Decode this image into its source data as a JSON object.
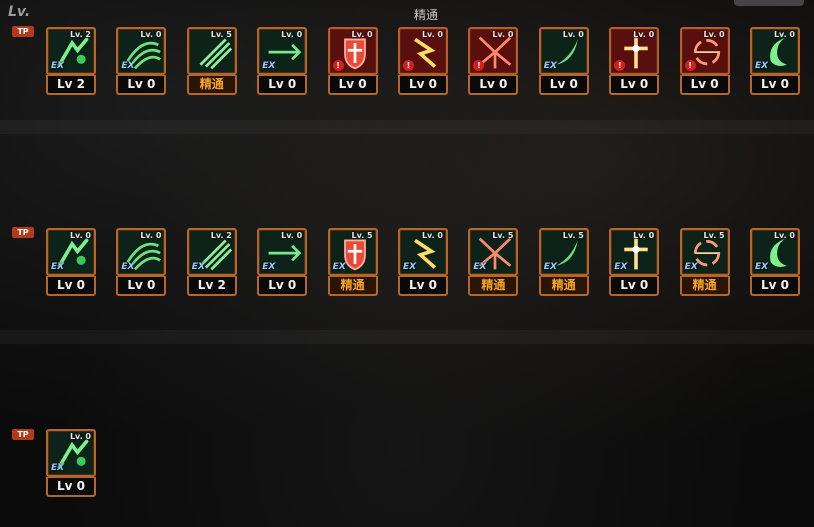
{
  "header": {
    "lv_label": "Lv.",
    "title": "精通"
  },
  "tp_label": "TP",
  "colors": {
    "accent_border": "#b5672a",
    "green_icon_bg": "#0d2218",
    "red_icon_bg": "#5a0f0f",
    "master_text": "#f3a325"
  },
  "rows": [
    {
      "slots": [
        {
          "mini": "Lv. 2",
          "badge": "EX",
          "red": false,
          "label": "Lv 2",
          "master": false,
          "icon": "kick-icon"
        },
        {
          "mini": "Lv. 0",
          "badge": "EX",
          "red": false,
          "label": "Lv 0",
          "master": false,
          "icon": "claw-slash-icon"
        },
        {
          "mini": "Lv. 5",
          "badge": "",
          "red": false,
          "label": "精通",
          "master": true,
          "icon": "triple-slash-icon"
        },
        {
          "mini": "Lv. 0",
          "badge": "EX",
          "red": false,
          "label": "Lv 0",
          "master": false,
          "icon": "sword-thrust-icon"
        },
        {
          "mini": "Lv. 0",
          "badge": "!",
          "red": true,
          "label": "Lv 0",
          "master": false,
          "icon": "shield-cross-icon"
        },
        {
          "mini": "Lv. 0",
          "badge": "!",
          "red": true,
          "label": "Lv 0",
          "master": false,
          "icon": "lightning-strike-icon"
        },
        {
          "mini": "Lv. 0",
          "badge": "!",
          "red": true,
          "label": "Lv 0",
          "master": false,
          "icon": "wing-burst-icon"
        },
        {
          "mini": "Lv. 0",
          "badge": "EX",
          "red": false,
          "label": "Lv 0",
          "master": false,
          "icon": "crescent-slash-icon"
        },
        {
          "mini": "Lv. 0",
          "badge": "!",
          "red": true,
          "label": "Lv 0",
          "master": false,
          "icon": "cross-sword-icon"
        },
        {
          "mini": "Lv. 0",
          "badge": "!",
          "red": true,
          "label": "Lv 0",
          "master": false,
          "icon": "whirlwind-icon"
        },
        {
          "mini": "Lv. 0",
          "badge": "EX",
          "red": false,
          "label": "Lv 0",
          "master": false,
          "icon": "crescent-moon-icon"
        }
      ]
    },
    {
      "slots": [
        {
          "mini": "Lv. 0",
          "badge": "EX",
          "red": false,
          "label": "Lv 0",
          "master": false,
          "icon": "star-slash-icon"
        },
        {
          "mini": "Lv. 0",
          "badge": "EX",
          "red": false,
          "label": "Lv 0",
          "master": false,
          "icon": "spiral-claw-icon"
        },
        {
          "mini": "Lv. 2",
          "badge": "EX",
          "red": false,
          "label": "Lv 2",
          "master": false,
          "icon": "x-slash-icon"
        },
        {
          "mini": "Lv. 0",
          "badge": "EX",
          "red": false,
          "label": "Lv 0",
          "master": false,
          "icon": "pagoda-icon"
        },
        {
          "mini": "Lv. 5",
          "badge": "EX",
          "red": false,
          "label": "精通",
          "master": true,
          "icon": "dash-arrow-icon"
        },
        {
          "mini": "Lv. 0",
          "badge": "EX",
          "red": false,
          "label": "Lv 0",
          "master": false,
          "icon": "blade-pillar-icon"
        },
        {
          "mini": "Lv. 5",
          "badge": "EX",
          "red": false,
          "label": "精通",
          "master": true,
          "icon": "leaping-figure-icon"
        },
        {
          "mini": "Lv. 5",
          "badge": "EX",
          "red": false,
          "label": "精通",
          "master": true,
          "icon": "kneeling-figure-icon"
        },
        {
          "mini": "Lv. 0",
          "badge": "EX",
          "red": false,
          "label": "Lv 0",
          "master": false,
          "icon": "swirl-figure-icon"
        },
        {
          "mini": "Lv. 5",
          "badge": "EX",
          "red": false,
          "label": "精通",
          "master": true,
          "icon": "charging-figure-icon"
        },
        {
          "mini": "Lv. 0",
          "badge": "EX",
          "red": false,
          "label": "Lv 0",
          "master": false,
          "icon": "flame-pillars-icon"
        }
      ]
    },
    {
      "slots": [
        {
          "mini": "Lv. 0",
          "badge": "EX",
          "red": false,
          "label": "Lv 0",
          "master": false,
          "icon": "shadow-burst-icon"
        }
      ]
    }
  ]
}
